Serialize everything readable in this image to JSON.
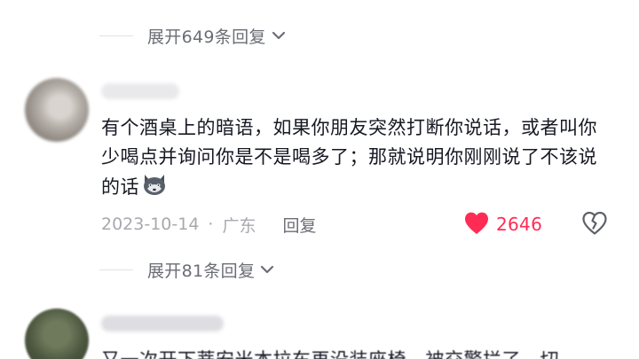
{
  "replies_top": {
    "label": "展开649条回复"
  },
  "comment": {
    "text": "有个酒桌上的暗语，如果你朋友突然打断你说话，或者叫你少喝点并询问你是不是喝多了；那就说明你刚刚说了不该说的话",
    "emoji": "wolf-emoji",
    "date": "2023-10-14",
    "separator": "·",
    "location": "广东",
    "reply_label": "回复",
    "like_count": "2646",
    "liked": true,
    "accent_color": "#fe2c55"
  },
  "replies_bottom": {
    "label": "展开81条回复"
  },
  "next_comment": {
    "text_partial": "又一次开下蒂安米本拉车再没装座椅，被交警拦了，切"
  },
  "icons": {
    "expand_chevron": "chevron-down-icon",
    "like": "heart-icon",
    "dislike": "broken-heart-icon"
  }
}
